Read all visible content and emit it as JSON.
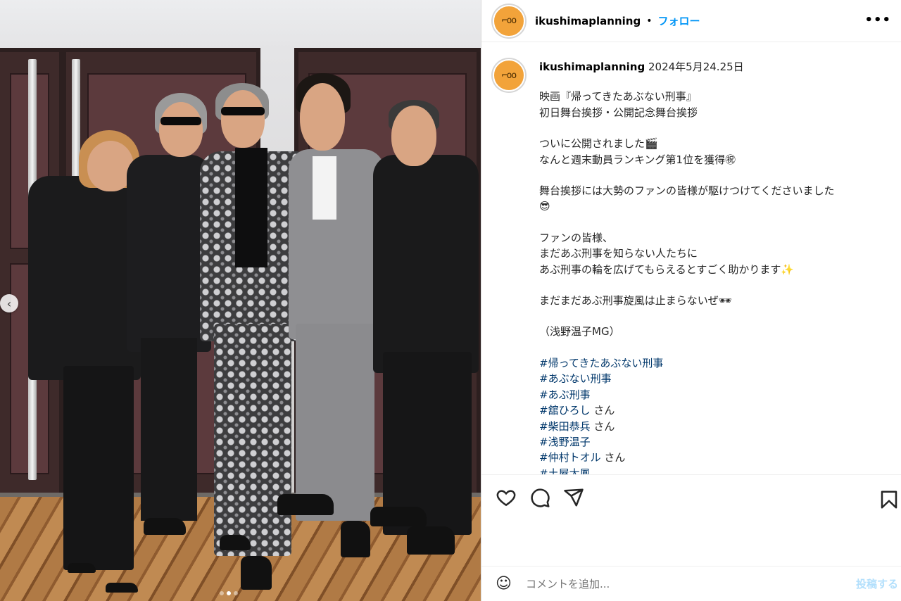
{
  "photo": {
    "carousel_prev": "‹"
  },
  "header": {
    "username": "ikushimaplanning",
    "separator": "•",
    "follow_label": "フォロー",
    "more_label": "•••"
  },
  "caption": {
    "username": "ikushimaplanning",
    "date": "2024年5月24.25日",
    "paragraphs": [
      "映画『帰ってきたあぶない刑事』\n初日舞台挨拶・公開記念舞台挨拶",
      "ついに公開されました🎬\nなんと週末動員ランキング第1位を獲得㊗",
      "舞台挨拶には大勢のファンの皆様が駆けつけてくださいました\n😎",
      "ファンの皆様、\nまだあぶ刑事を知らない人たちに\nあぶ刑事の輪を広げてもらえるとすごく助かります✨",
      "まだまだあぶ刑事旋風は止まらないぜ🕶",
      "（浅野温子MG）"
    ],
    "hashtags": [
      {
        "tag": "#帰ってきたあぶない刑事",
        "suffix": ""
      },
      {
        "tag": "#あぶない刑事",
        "suffix": ""
      },
      {
        "tag": "#あぶ刑事",
        "suffix": ""
      },
      {
        "tag": "#舘ひろし",
        "suffix": " さん"
      },
      {
        "tag": "#柴田恭兵",
        "suffix": " さん"
      },
      {
        "tag": "#浅野温子",
        "suffix": ""
      },
      {
        "tag": "#仲村トオル",
        "suffix": " さん"
      },
      {
        "tag": "#土屋太鳳",
        "suffix": ""
      }
    ]
  },
  "actions": {
    "like_icon": "heart-icon",
    "comment_icon": "comment-icon",
    "share_icon": "share-icon",
    "save_icon": "bookmark-icon"
  },
  "comment": {
    "emoji_icon": "☺",
    "placeholder": "コメントを追加...",
    "post_label": "投稿する"
  },
  "colors": {
    "link": "#0095f6",
    "hashtag": "#00376b",
    "post_disabled": "#b2dffc"
  }
}
